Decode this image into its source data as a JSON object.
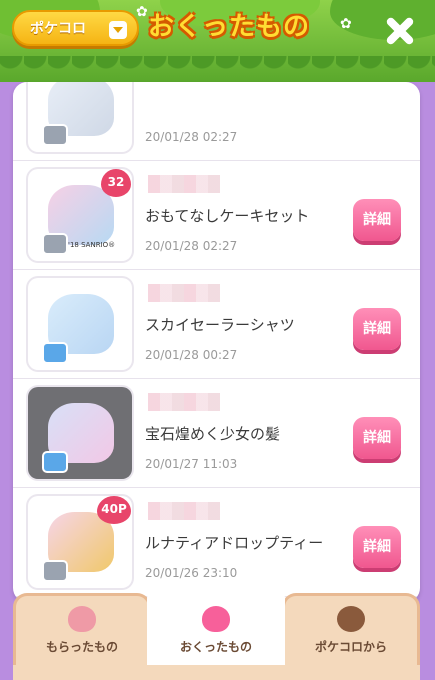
{
  "header": {
    "account_dropdown_label": "ポケコロ",
    "title": "おくったもの",
    "close_icon": "close-icon"
  },
  "items": [
    {
      "name": "",
      "date": "20/01/28 02:27",
      "price_badge": "",
      "thumb_colors": [
        "#e8eef7",
        "#cfd8e6"
      ]
    },
    {
      "name": "おもてなしケーキセット",
      "date": "20/01/28 02:27",
      "price_badge": "32",
      "copyright": "©'76,'18 SANRIO®",
      "thumb_colors": [
        "#f7d0e5",
        "#b7d9f3"
      ]
    },
    {
      "name": "スカイセーラーシャツ",
      "date": "20/01/28 00:27",
      "price_badge": "",
      "thumb_colors": [
        "#d9ecfb",
        "#b9d6f3"
      ]
    },
    {
      "name": "宝石煌めく少女の髪",
      "date": "20/01/27 11:03",
      "price_badge": "",
      "thumb_colors": [
        "#d8e0f7",
        "#f2c8e6"
      ]
    },
    {
      "name": "ルナティアドロップティー",
      "date": "20/01/26 23:10",
      "price_badge": "40P",
      "thumb_colors": [
        "#f6d5e8",
        "#f0c86a"
      ]
    },
    {
      "name": "",
      "date": "",
      "price_badge": "",
      "thumb_colors": [
        "#f4f4f6",
        "#e8e8ec"
      ]
    }
  ],
  "detail_button_label": "詳細",
  "tabs": [
    {
      "label": "もらったもの",
      "icon": "received-gift-icon",
      "active": false
    },
    {
      "label": "おくったもの",
      "icon": "sent-gift-icon",
      "active": true
    },
    {
      "label": "ポケコロから",
      "icon": "pokecolo-avatar-icon",
      "active": false
    }
  ],
  "colors": {
    "header_green": "#6fbf33",
    "title_yellow": "#ffdd33",
    "detail_pink": "#f0578f",
    "tab_beige": "#f4d9bc",
    "background_purple": "#b98de0"
  }
}
